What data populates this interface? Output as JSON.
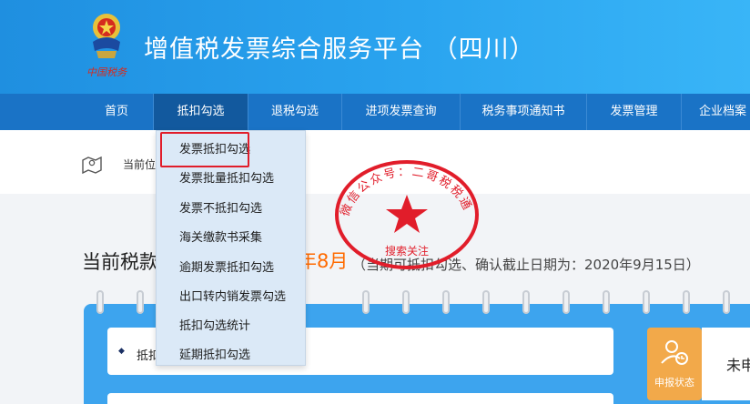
{
  "header": {
    "title": "增值税发票综合服务平台 （四川）",
    "logo_text": "中国税务",
    "colors": {
      "start": "#1f8fe0",
      "end": "#39b5f7"
    }
  },
  "nav": {
    "items": [
      {
        "label": "首页",
        "active": false
      },
      {
        "label": "抵扣勾选",
        "active": true
      },
      {
        "label": "退税勾选",
        "active": false
      },
      {
        "label": "进项发票查询",
        "active": false
      },
      {
        "label": "税务事项通知书",
        "active": false
      },
      {
        "label": "发票管理",
        "active": false
      },
      {
        "label": "企业档案",
        "active": false
      }
    ]
  },
  "breadcrumb": {
    "icon": "map-icon",
    "text": "当前位"
  },
  "dropdown": {
    "items": [
      {
        "label": "发票抵扣勾选",
        "highlighted": true
      },
      {
        "label": "发票批量抵扣勾选"
      },
      {
        "label": "发票不抵扣勾选"
      },
      {
        "label": "海关缴款书采集"
      },
      {
        "label": "逾期发票抵扣勾选"
      },
      {
        "label": "出口转内销发票勾选"
      },
      {
        "label": "抵扣勾选统计"
      },
      {
        "label": "延期抵扣勾选"
      }
    ]
  },
  "period": {
    "label": "当前税款",
    "month": "年8月",
    "note": "（当期可抵扣勾选、确认截止日期为：2020年9月15日）"
  },
  "card": {
    "label": "抵扣"
  },
  "status": {
    "label": "申报状态",
    "value": "未申",
    "icon": "person-clock-icon"
  },
  "watermark": {
    "text_ring": "微信公众号：二哥税税通",
    "caption": "搜索关注",
    "color": "#e11d2a"
  }
}
